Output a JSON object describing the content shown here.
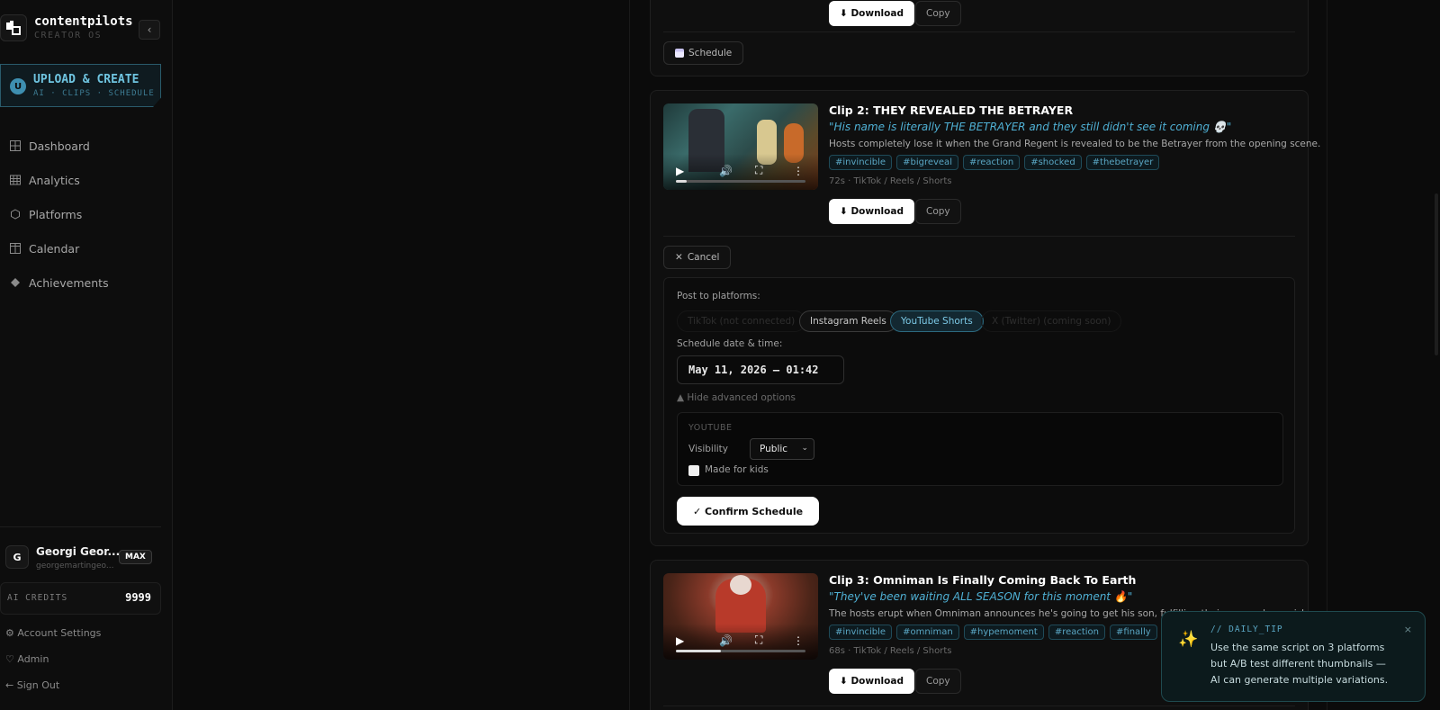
{
  "brand": {
    "name": "contentpilots",
    "subtitle": "CREATOR OS"
  },
  "upload": {
    "badge": "U",
    "title": "UPLOAD & CREATE",
    "subtitle": "AI · CLIPS · SCHEDULE"
  },
  "nav": [
    {
      "label": "Dashboard",
      "icon": "grid-icon"
    },
    {
      "label": "Analytics",
      "icon": "table-icon"
    },
    {
      "label": "Platforms",
      "icon": "hexagon-icon"
    },
    {
      "label": "Calendar",
      "icon": "columns-icon"
    },
    {
      "label": "Achievements",
      "icon": "diamond-icon"
    }
  ],
  "user": {
    "initial": "G",
    "name": "Georgi Geor...",
    "email": "georgemartingeo...",
    "plan": "MAX"
  },
  "credits": {
    "label": "AI CREDITS",
    "value": "9999"
  },
  "sidebar_links": {
    "account": "⚙ Account Settings",
    "admin": "♡ Admin",
    "signout": "← Sign Out"
  },
  "top_card": {
    "download": "⬇ Download",
    "copy": "Copy",
    "schedule": "Schedule"
  },
  "clip2": {
    "title": "Clip 2: THEY REVEALED THE BETRAYER",
    "quote": "\"His name is literally THE BETRAYER and they still didn't see it coming 💀\"",
    "description": "Hosts completely lose it when the Grand Regent is revealed to be the Betrayer from the opening scene.",
    "tags": [
      "#invincible",
      "#bigreveal",
      "#reaction",
      "#shocked",
      "#thebetrayer"
    ],
    "meta": "72s · TikTok / Reels / Shorts",
    "download": "⬇ Download",
    "copy": "Copy",
    "progress": 0.08
  },
  "schedule": {
    "cancel": "Cancel",
    "post_to": "Post to platforms:",
    "platforms": [
      {
        "label": "TikTok (not connected)",
        "state": "disabled"
      },
      {
        "label": "Instagram Reels",
        "state": "normal"
      },
      {
        "label": "YouTube Shorts",
        "state": "active"
      },
      {
        "label": "X (Twitter) (coming soon)",
        "state": "disabled"
      }
    ],
    "date_label": "Schedule date & time:",
    "date_value": "May 11, 2026 — 01:42",
    "advanced_toggle": "▲ Hide advanced options",
    "youtube": {
      "section": "YOUTUBE",
      "visibility_label": "Visibility",
      "visibility_value": "Public",
      "kids_label": "Made for kids",
      "kids_checked": false
    },
    "confirm": "✓ Confirm Schedule"
  },
  "clip3": {
    "title": "Clip 3: Omniman Is Finally Coming Back To Earth",
    "quote": "\"They've been waiting ALL SEASON for this moment 🔥\"",
    "description": "The hosts erupt when Omniman announces he's going to get his son, fulfilling their season-long wish.",
    "tags": [
      "#invincible",
      "#omniman",
      "#hypemoment",
      "#reaction",
      "#finally"
    ],
    "meta": "68s · TikTok / Reels / Shorts",
    "download": "⬇ Download",
    "copy": "Copy",
    "progress": 0.35
  },
  "tip": {
    "heading": "// DAILY_TIP",
    "body": "Use the same script on 3 platforms but A/B test different thumbnails — AI can generate multiple variations.",
    "close": "×"
  }
}
